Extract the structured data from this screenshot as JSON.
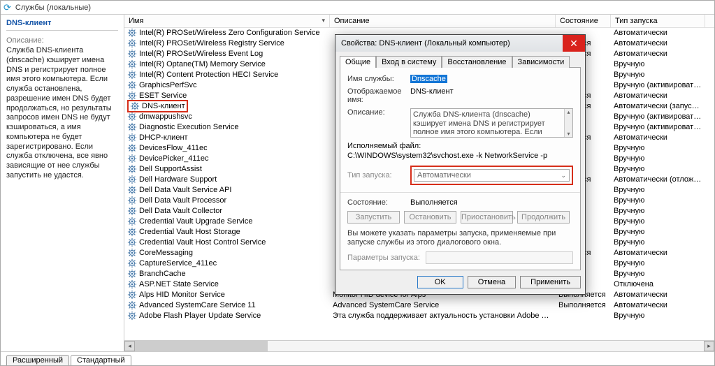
{
  "window": {
    "title": "Службы (локальные)"
  },
  "leftPanel": {
    "title": "DNS-клиент",
    "subhead": "Описание:",
    "description": "Служба DNS-клиента (dnscache) кэширует имена DNS и регистрирует полное имя этого компьютера. Если служба остановлена, разрешение имен DNS будет продолжаться, но результаты запросов имен DNS не будут кэшироваться, а имя компьютера не будет зарегистрировано. Если служба отключена, все явно зависящие от нее службы запустить не удастся."
  },
  "columns": {
    "name": "Имя",
    "desc": "Описание",
    "state": "Состояние",
    "start": "Тип запуска"
  },
  "services": [
    {
      "name": "Intel(R) PROSet/Wireless Zero Configuration Service",
      "state": "",
      "start": "Автоматически"
    },
    {
      "name": "Intel(R) PROSet/Wireless Registry Service",
      "state": "олняется",
      "start": "Автоматически"
    },
    {
      "name": "Intel(R) PROSet/Wireless Event Log",
      "state": "олняется",
      "start": "Автоматически"
    },
    {
      "name": "Intel(R) Optane(TM) Memory Service",
      "state": "",
      "start": "Вручную"
    },
    {
      "name": "Intel(R) Content Protection HECI Service",
      "state": "",
      "start": "Вручную"
    },
    {
      "name": "GraphicsPerfSvc",
      "state": "",
      "start": "Вручную (активировать з..."
    },
    {
      "name": "ESET Service",
      "state": "олняется",
      "start": "Автоматически"
    },
    {
      "name": "DNS-клиент",
      "highlight": true,
      "state": "олняется",
      "start": "Автоматически (запуск п..."
    },
    {
      "name": "dmwappushsvc",
      "state": "",
      "start": "Вручную (активировать з..."
    },
    {
      "name": "Diagnostic Execution Service",
      "state": "",
      "start": "Вручную (активировать з..."
    },
    {
      "name": "DHCP-клиент",
      "state": "олняется",
      "start": "Автоматически"
    },
    {
      "name": "DevicesFlow_411ec",
      "state": "",
      "start": "Вручную"
    },
    {
      "name": "DevicePicker_411ec",
      "state": "",
      "start": "Вручную"
    },
    {
      "name": "Dell SupportAssist",
      "state": "",
      "start": "Вручную"
    },
    {
      "name": "Dell Hardware Support",
      "state": "олняется",
      "start": "Автоматически (отложе..."
    },
    {
      "name": "Dell Data Vault Service API",
      "state": "",
      "start": "Вручную"
    },
    {
      "name": "Dell Data Vault Processor",
      "state": "",
      "start": "Вручную"
    },
    {
      "name": "Dell Data Vault Collector",
      "state": "",
      "start": "Вручную"
    },
    {
      "name": "Credential Vault Upgrade Service",
      "state": "",
      "start": "Вручную"
    },
    {
      "name": "Credential Vault Host Storage",
      "state": "",
      "start": "Вручную"
    },
    {
      "name": "Credential Vault Host Control Service",
      "state": "",
      "start": "Вручную"
    },
    {
      "name": "CoreMessaging",
      "state": "олняется",
      "start": "Автоматически"
    },
    {
      "name": "CaptureService_411ec",
      "state": "",
      "start": "Вручную"
    },
    {
      "name": "BranchCache",
      "state": "",
      "start": "Вручную"
    },
    {
      "name": "ASP.NET State Service",
      "state": "",
      "start": "Отключена"
    },
    {
      "name": "Alps HID Monitor Service",
      "desc": "Monitor HID device for Alps",
      "state": "Выполняется",
      "start": "Автоматически"
    },
    {
      "name": "Advanced SystemCare Service 11",
      "desc": "Advanced SystemCare Service",
      "state": "Выполняется",
      "start": "Автоматически"
    },
    {
      "name": "Adobe Flash Player Update Service",
      "desc": "Эта служба поддерживает актуальность установки Adobe Flash Playe...",
      "state": "",
      "start": "Вручную"
    }
  ],
  "tabs": {
    "extended": "Расширенный",
    "standard": "Стандартный"
  },
  "dialog": {
    "title": "Свойства: DNS-клиент (Локальный компьютер)",
    "tabs": {
      "general": "Общие",
      "logon": "Вход в систему",
      "recovery": "Восстановление",
      "deps": "Зависимости"
    },
    "labels": {
      "serviceName": "Имя службы:",
      "displayName": "Отображаемое имя:",
      "description": "Описание:",
      "execFile": "Исполняемый файл:",
      "startType": "Тип запуска:",
      "state": "Состояние:",
      "paramsLabel": "Параметры запуска:"
    },
    "values": {
      "serviceName": "Dnscache",
      "displayName": "DNS-клиент",
      "description": "Служба DNS-клиента (dnscache) кэширует имена DNS и регистрирует полное имя этого компьютера. Если служба остановлена, разрешение имен DNS будет продолжаться, но",
      "execPath": "C:\\WINDOWS\\system32\\svchost.exe -k NetworkService -p",
      "startType": "Автоматически",
      "state": "Выполняется"
    },
    "buttons": {
      "start": "Запустить",
      "stop": "Остановить",
      "pause": "Приостановить",
      "resume": "Продолжить"
    },
    "hint": "Вы можете указать параметры запуска, применяемые при запуске службы из этого диалогового окна.",
    "footer": {
      "ok": "OK",
      "cancel": "Отмена",
      "apply": "Применить"
    }
  }
}
